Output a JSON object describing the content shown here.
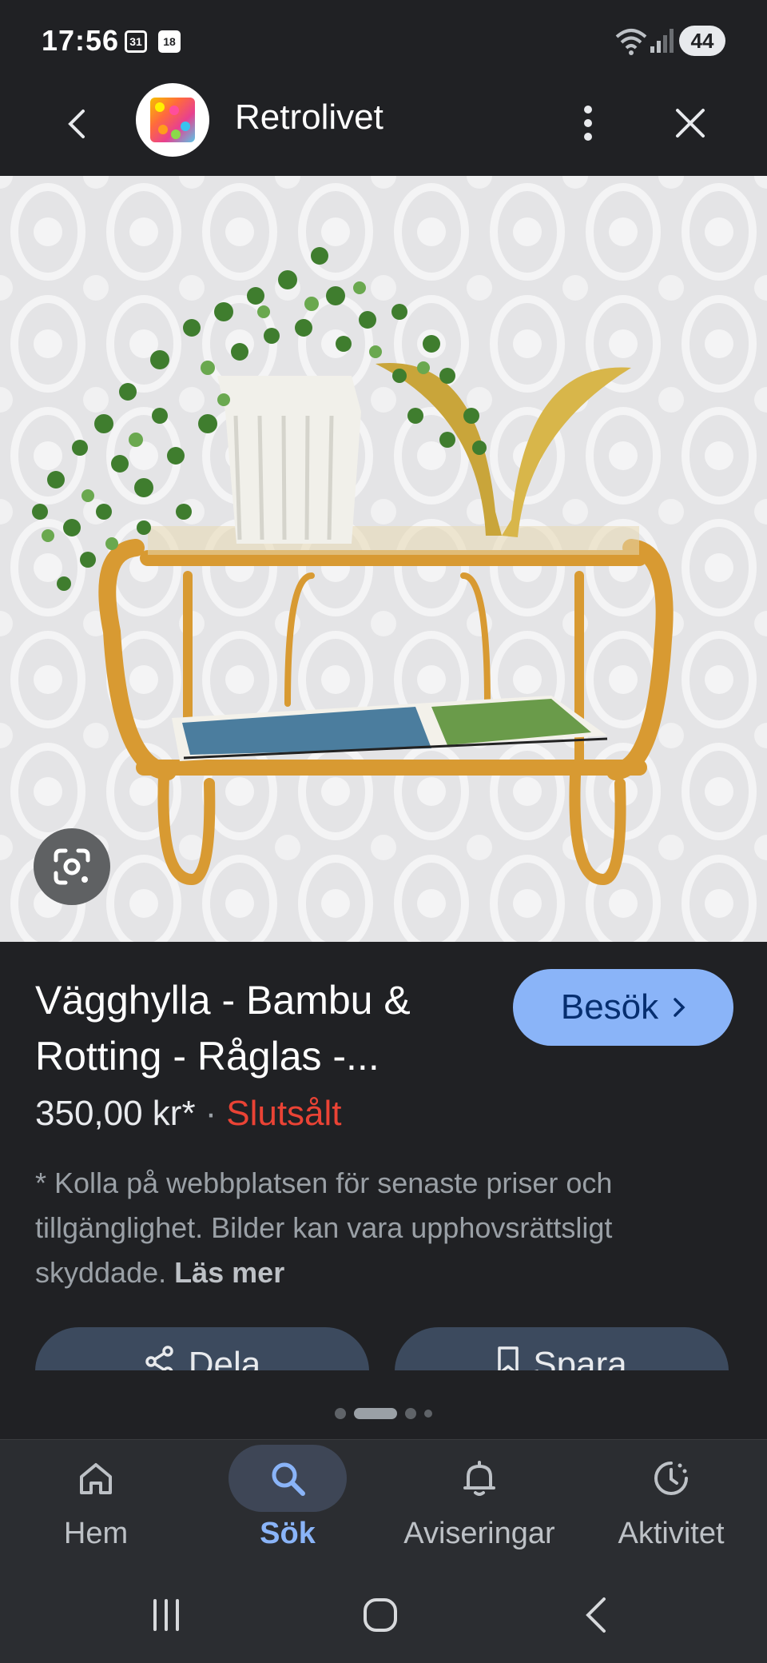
{
  "status_bar": {
    "time": "17:56",
    "calendar_icon_1": "31",
    "calendar_icon_2": "18",
    "battery": "44"
  },
  "header": {
    "site_name": "Retrolivet",
    "icons": [
      "back-arrow-icon",
      "site-logo",
      "more-vertical-icon",
      "close-icon"
    ]
  },
  "image": {
    "alt": "Bamboo and rattan wall shelf with plant, brass decoration and magazine",
    "lens_icon": "google-lens-icon"
  },
  "product": {
    "title": "Vägghylla - Bambu & Rotting - Råglas -...",
    "price": "350,00 kr*",
    "separator": "·",
    "availability": "Slutsålt",
    "visit_button": "Besök",
    "disclaimer": "* Kolla på webbplatsen för senaste priser och tillgänglighet. Bilder kan vara upphovsrättsligt skyddade.",
    "read_more": "Läs mer",
    "share_button": "Dela",
    "save_button": "Spara"
  },
  "colors": {
    "background": "#202124",
    "accent": "#8ab4f8",
    "sold_out": "#ea4335",
    "action_button": "#3c4a5e"
  },
  "bottom_nav": {
    "items": [
      {
        "label": "Hem",
        "icon": "home-icon"
      },
      {
        "label": "Sök",
        "icon": "search-icon",
        "active": true
      },
      {
        "label": "Aviseringar",
        "icon": "bell-icon"
      },
      {
        "label": "Aktivitet",
        "icon": "activity-icon"
      }
    ]
  },
  "system_nav": [
    "recents-icon",
    "home-circle-icon",
    "back-chevron-icon"
  ]
}
